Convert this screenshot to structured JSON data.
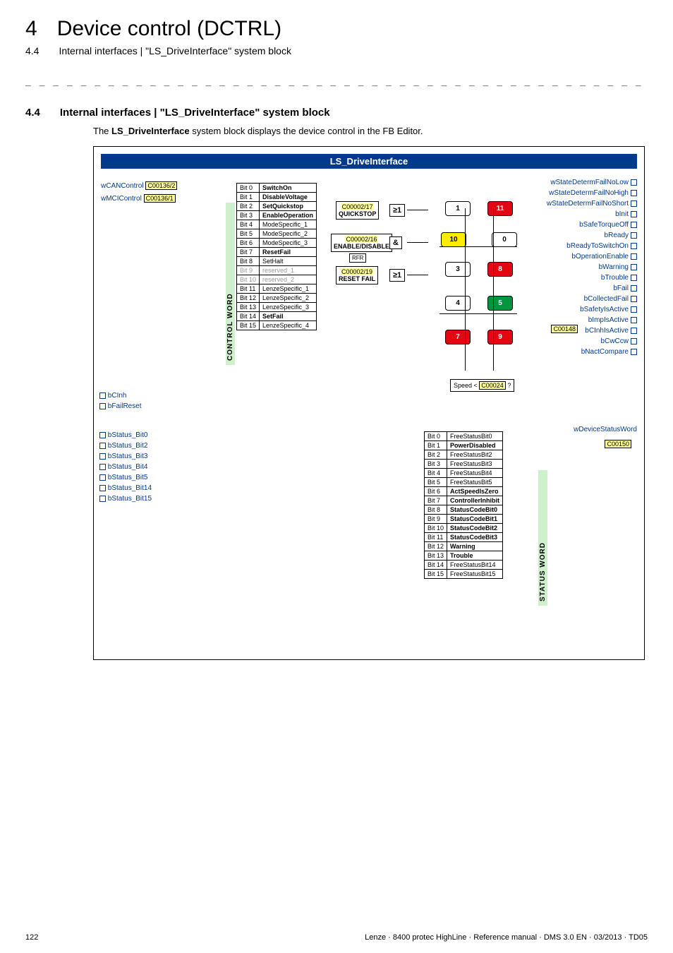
{
  "header": {
    "chapter_num": "4",
    "chapter_title": "Device control (DCTRL)",
    "sub_num": "4.4",
    "sub_title": "Internal interfaces | \"LS_DriveInterface\" system block"
  },
  "section": {
    "num": "4.4",
    "title": "Internal interfaces | \"LS_DriveInterface\" system block",
    "intro_pre": "The ",
    "intro_bold": "LS_DriveInterface",
    "intro_post": " system block displays the device control in the FB Editor."
  },
  "diagram": {
    "title": "LS_DriveInterface",
    "inputs_top": [
      {
        "name": "wCANControl",
        "code": "C00136/2"
      },
      {
        "name": "wMCIControl",
        "code": "C00136/1"
      }
    ],
    "control_word_label": "CONTROL WORD",
    "control_word_bits": [
      {
        "bit": "Bit 0",
        "label": "SwitchOn",
        "bold": true
      },
      {
        "bit": "Bit 1",
        "label": "DisableVoltage",
        "bold": true
      },
      {
        "bit": "Bit 2",
        "label": "SetQuickstop",
        "bold": true
      },
      {
        "bit": "Bit 3",
        "label": "EnableOperation",
        "bold": true
      },
      {
        "bit": "Bit 4",
        "label": "ModeSpecific_1",
        "bold": false
      },
      {
        "bit": "Bit 5",
        "label": "ModeSpecific_2",
        "bold": false
      },
      {
        "bit": "Bit 6",
        "label": "ModeSpecific_3",
        "bold": false
      },
      {
        "bit": "Bit 7",
        "label": "ResetFail",
        "bold": true
      },
      {
        "bit": "Bit 8",
        "label": "SetHalt",
        "bold": false
      },
      {
        "bit": "Bit 9",
        "label": "reserved_1",
        "grey": true
      },
      {
        "bit": "Bit 10",
        "label": "reserved_2",
        "grey": true
      },
      {
        "bit": "Bit 11",
        "label": "LenzeSpecific_1",
        "bold": false
      },
      {
        "bit": "Bit 12",
        "label": "LenzeSpecific_2",
        "bold": false
      },
      {
        "bit": "Bit 13",
        "label": "LenzeSpecific_3",
        "bold": false
      },
      {
        "bit": "Bit 14",
        "label": "SetFail",
        "bold": true
      },
      {
        "bit": "Bit 15",
        "label": "LenzeSpecific_4",
        "bold": false
      }
    ],
    "logic_blocks": {
      "quickstop": {
        "code": "C00002/17",
        "label": "QUICKSTOP",
        "gate": "≥1"
      },
      "enable": {
        "code": "C00002/16",
        "label": "ENABLE/DISABLE",
        "gate": "&"
      },
      "rfr": "RFR",
      "resetfail": {
        "code": "C00002/19",
        "label": "RESET FAIL",
        "gate": "≥1"
      }
    },
    "states": [
      "1",
      "11",
      "10",
      "0",
      "3",
      "8",
      "4",
      "5",
      "7",
      "9"
    ],
    "state_styles": {
      "1": "white",
      "11": "red",
      "10": "yellow",
      "0": "white",
      "3": "white",
      "8": "red",
      "4": "white",
      "5": "green",
      "7": "red",
      "9": "red"
    },
    "speed_box": {
      "label_pre": "Speed < ",
      "code": "C00024",
      "label_post": " ?"
    },
    "inputs_bottom": [
      "bCInh",
      "bFailReset"
    ],
    "bstatus_inputs": [
      "bStatus_Bit0",
      "bStatus_Bit2",
      "bStatus_Bit3",
      "bStatus_Bit4",
      "bStatus_Bit5",
      "bStatus_Bit14",
      "bStatus_Bit15"
    ],
    "status_word_label": "STATUS WORD",
    "status_word_bits": [
      {
        "bit": "Bit 0",
        "label": "FreeStatusBit0",
        "bold": false
      },
      {
        "bit": "Bit 1",
        "label": "PowerDisabled",
        "bold": true
      },
      {
        "bit": "Bit 2",
        "label": "FreeStatusBit2",
        "bold": false
      },
      {
        "bit": "Bit 3",
        "label": "FreeStatusBit3",
        "bold": false
      },
      {
        "bit": "Bit 4",
        "label": "FreeStatusBit4",
        "bold": false
      },
      {
        "bit": "Bit 5",
        "label": "FreeStatusBit5",
        "bold": false
      },
      {
        "bit": "Bit 6",
        "label": "ActSpeedIsZero",
        "bold": true
      },
      {
        "bit": "Bit 7",
        "label": "ControllerInhibit",
        "bold": true
      },
      {
        "bit": "Bit 8",
        "label": "StatusCodeBit0",
        "bold": true
      },
      {
        "bit": "Bit 9",
        "label": "StatusCodeBit1",
        "bold": true
      },
      {
        "bit": "Bit 10",
        "label": "StatusCodeBit2",
        "bold": true
      },
      {
        "bit": "Bit 11",
        "label": "StatusCodeBit3",
        "bold": true
      },
      {
        "bit": "Bit 12",
        "label": "Warning",
        "bold": true
      },
      {
        "bit": "Bit 13",
        "label": "Trouble",
        "bold": true
      },
      {
        "bit": "Bit 14",
        "label": "FreeStatusBit14",
        "bold": false
      },
      {
        "bit": "Bit 15",
        "label": "FreeStatusBit15",
        "bold": false
      }
    ],
    "outputs": [
      "wStateDetermFailNoLow",
      "wStateDetermFailNoHigh",
      "wStateDetermFailNoShort",
      "bInit",
      "bSafeTorqueOff",
      "bReady",
      "bReadyToSwitchOn",
      "bOperationEnable",
      "bWarning",
      "bTrouble",
      "bFail",
      "bCollectedFail",
      "bSafetyIsActive",
      "bImpIsActive",
      "bCInhIsActive",
      "bCwCcw",
      "bNactCompare"
    ],
    "collected_fail_code": "C00148",
    "wdevice": {
      "label": "wDeviceStatusWord",
      "code": "C00150"
    }
  },
  "footer": {
    "page": "122",
    "right": "Lenze · 8400 protec HighLine · Reference manual · DMS 3.0 EN · 03/2013 · TD05"
  }
}
